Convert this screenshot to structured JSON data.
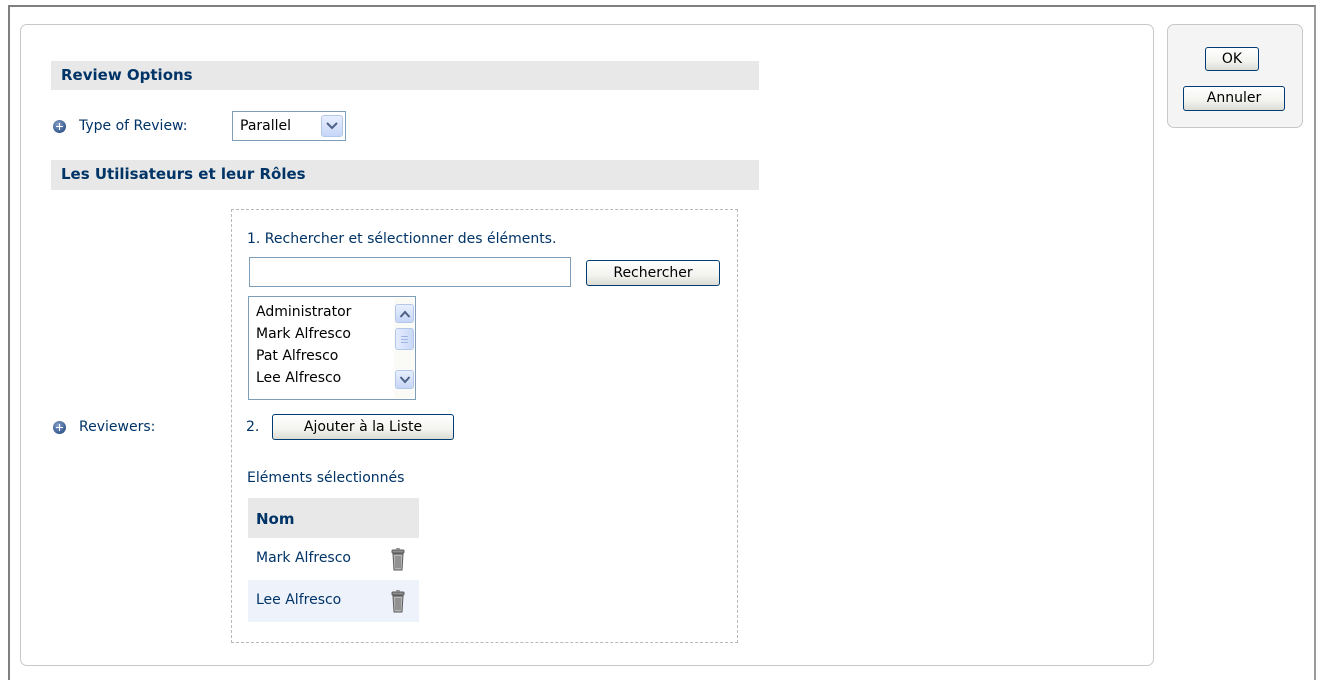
{
  "review_options": {
    "header": "Review Options",
    "type_label": "Type of Review:",
    "type_value": "Parallel"
  },
  "users_roles": {
    "header": "Les Utilisateurs et leur Rôles",
    "reviewers_label": "Reviewers:",
    "step1_label": "1. Rechercher et sélectionner des éléments.",
    "search_value": "",
    "search_button": "Rechercher",
    "available_users": [
      "Administrator",
      "Mark Alfresco",
      "Pat Alfresco",
      "Lee Alfresco"
    ],
    "step2_number": "2.",
    "add_button": "Ajouter à la Liste",
    "selected_title": "Eléments sélectionnés",
    "table_header": "Nom",
    "selected_rows": [
      "Mark Alfresco",
      "Lee Alfresco"
    ]
  },
  "actions": {
    "ok": "OK",
    "cancel": "Annuler"
  },
  "colors": {
    "section_bg": "#e8e8e8",
    "text": "#003366",
    "row_alt": "#eef3fb"
  },
  "icons": {
    "bullet": "blue-plus-bullet-icon",
    "dropdown": "chevron-down-icon",
    "delete": "trash-icon"
  }
}
